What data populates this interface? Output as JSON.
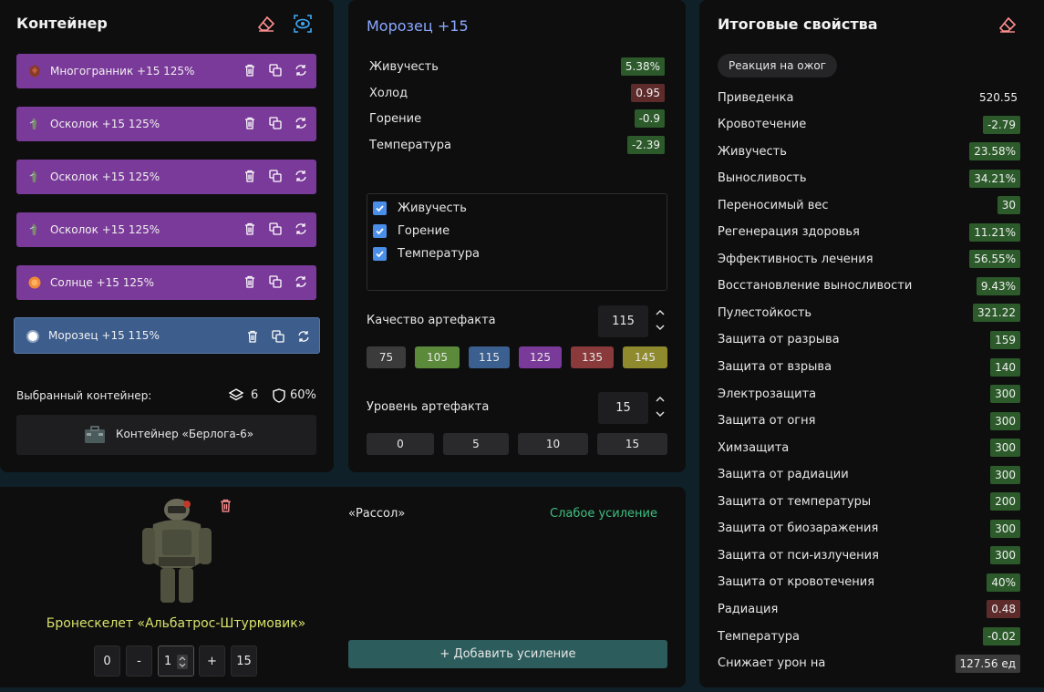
{
  "container": {
    "title": "Контейнер",
    "items": [
      {
        "label": "Многогранник +15 125%",
        "icon": "polyhedron-icon"
      },
      {
        "label": "Осколок +15 125%",
        "icon": "shard-icon"
      },
      {
        "label": "Осколок +15 125%",
        "icon": "shard-icon"
      },
      {
        "label": "Осколок +15 125%",
        "icon": "shard-icon"
      },
      {
        "label": "Солнце +15 125%",
        "icon": "sun-icon"
      },
      {
        "label": "Морозец +15 115%",
        "icon": "frost-icon"
      }
    ],
    "selected_label": "Выбранный контейнер:",
    "slots": "6",
    "protection": "60%",
    "container_name": "Контейнер «Берлога-6»"
  },
  "artifact": {
    "title": "Морозец +15",
    "stats": [
      {
        "name": "Живучесть",
        "value": "5.38%",
        "kind": "pos"
      },
      {
        "name": "Холод",
        "value": "0.95",
        "kind": "neg"
      },
      {
        "name": "Горение",
        "value": "-0.9",
        "kind": "pos"
      },
      {
        "name": "Температура",
        "value": "-2.39",
        "kind": "pos"
      }
    ],
    "checks": [
      {
        "label": "Живучесть",
        "checked": true
      },
      {
        "label": "Горение",
        "checked": true
      },
      {
        "label": "Температура",
        "checked": true
      }
    ],
    "quality_label": "Качество артефакта",
    "quality_value": "115",
    "quality_options": [
      {
        "label": "75",
        "color": "#3b3b3b"
      },
      {
        "label": "105",
        "color": "#5b8a3a"
      },
      {
        "label": "115",
        "color": "#3b5f8f"
      },
      {
        "label": "125",
        "color": "#7a3a99"
      },
      {
        "label": "135",
        "color": "#8a3a3a"
      },
      {
        "label": "145",
        "color": "#8f8a2e"
      }
    ],
    "level_label": "Уровень артефакта",
    "level_value": "15",
    "level_options": [
      "0",
      "5",
      "10",
      "15"
    ]
  },
  "totals": {
    "title": "Итоговые свойства",
    "reaction_chip": "Реакция на ожог",
    "rows": [
      {
        "name": "Приведенка",
        "value": "520.55",
        "kind": "neutral"
      },
      {
        "name": "Кровотечение",
        "value": "-2.79",
        "kind": "pos"
      },
      {
        "name": "Живучесть",
        "value": "23.58%",
        "kind": "pos"
      },
      {
        "name": "Выносливость",
        "value": "34.21%",
        "kind": "pos"
      },
      {
        "name": "Переносимый вес",
        "value": "30",
        "kind": "pos"
      },
      {
        "name": "Регенерация здоровья",
        "value": "11.21%",
        "kind": "pos"
      },
      {
        "name": "Эффективность лечения",
        "value": "56.55%",
        "kind": "pos"
      },
      {
        "name": "Восстановление выносливости",
        "value": "9.43%",
        "kind": "pos"
      },
      {
        "name": "Пулестойкость",
        "value": "321.22",
        "kind": "pos"
      },
      {
        "name": "Защита от разрыва",
        "value": "159",
        "kind": "pos"
      },
      {
        "name": "Защита от взрыва",
        "value": "140",
        "kind": "pos"
      },
      {
        "name": "Электрозащита",
        "value": "300",
        "kind": "pos"
      },
      {
        "name": "Защита от огня",
        "value": "300",
        "kind": "pos"
      },
      {
        "name": "Химзащита",
        "value": "300",
        "kind": "pos"
      },
      {
        "name": "Защита от радиации",
        "value": "300",
        "kind": "pos"
      },
      {
        "name": "Защита от температуры",
        "value": "200",
        "kind": "pos"
      },
      {
        "name": "Защита от биозаражения",
        "value": "300",
        "kind": "pos"
      },
      {
        "name": "Защита от пси-излучения",
        "value": "300",
        "kind": "pos"
      },
      {
        "name": "Защита от кровотечения",
        "value": "40%",
        "kind": "pos"
      },
      {
        "name": "Радиация",
        "value": "0.48",
        "kind": "neg"
      },
      {
        "name": "Температура",
        "value": "-0.02",
        "kind": "pos"
      },
      {
        "name": "Снижает урон на",
        "value": "127.56 ед",
        "kind": "grey"
      }
    ]
  },
  "armor": {
    "name": "Бронескелет «Альбатрос-Штурмовик»",
    "upgrade_tag": "«Рассол»",
    "upgrade_strength": "Слабое усиление",
    "add_upgrade": "+ Добавить усиление",
    "stepper": {
      "min": "0",
      "minus": "-",
      "value": "1",
      "plus": "+",
      "max": "15"
    }
  },
  "colors": {
    "accent_blue": "#8aa8ff",
    "positive": "#2c5a2a",
    "negative": "#5e2b2b",
    "armor_name": "#d8e36a",
    "upgrade_green": "#3fbf7f",
    "add_button": "#2d5c5c",
    "eraser": "#ff8f8f",
    "eye": "#3fa9f5"
  }
}
